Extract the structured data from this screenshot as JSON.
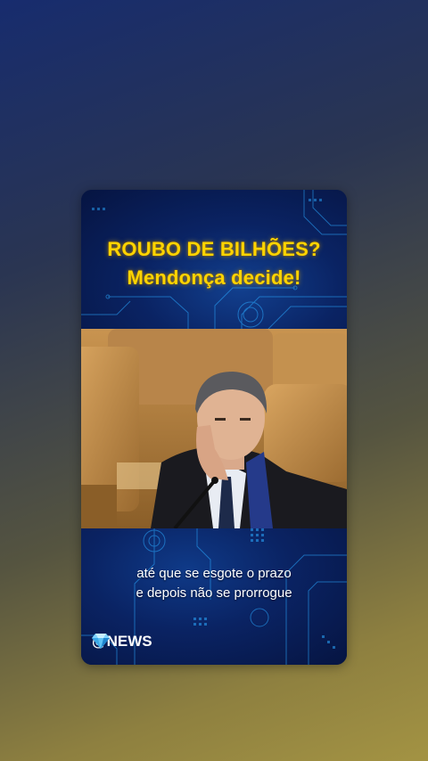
{
  "card": {
    "headline_line1": "ROUBO DE BILHÕES?",
    "headline_line2": "Mendonça decide!",
    "caption_line1": "até que se esgote o prazo",
    "caption_line2": "e depois não se prorrogue",
    "brand_label": "@NEWS",
    "brand_icon": "diamond-icon"
  },
  "colors": {
    "headline": "#ffd400",
    "panel": "#0a2363",
    "accent": "#2aa8ff"
  }
}
